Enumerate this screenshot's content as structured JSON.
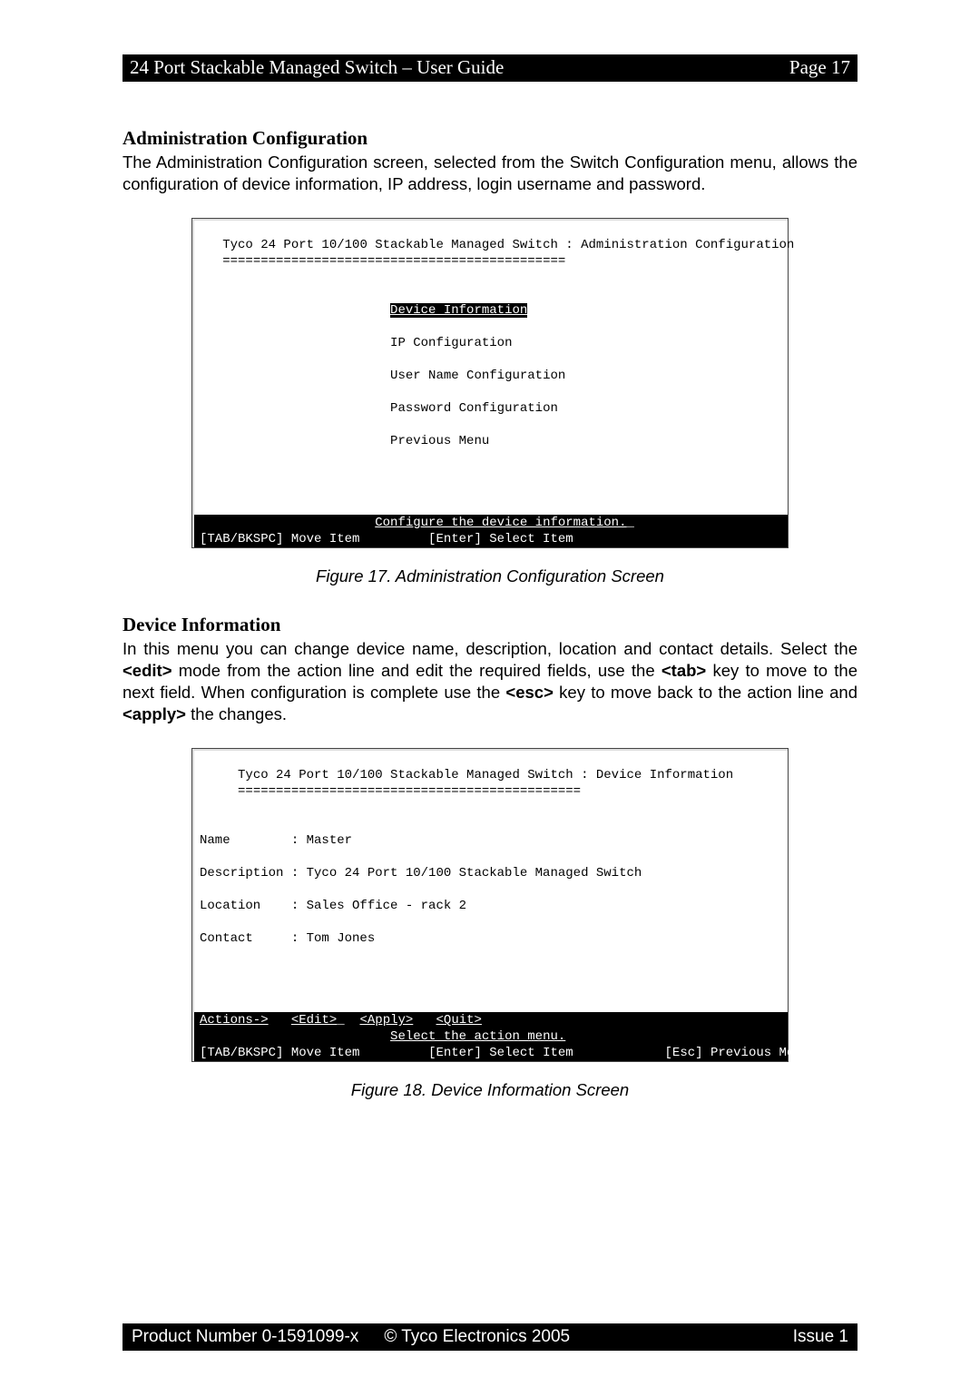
{
  "header": {
    "title": "24 Port Stackable Managed Switch – User Guide",
    "page_label": "Page 17"
  },
  "section1": {
    "heading": "Administration Configuration",
    "body": "The Administration Configuration screen, selected from the Switch Configuration menu, allows the configuration of device information, IP address, login username and password."
  },
  "terminal1": {
    "title": "Tyco 24 Port 10/100 Stackable Managed Switch : Administration Configuration",
    "rule": "=============================================",
    "menu": {
      "item1": "Device Information",
      "item2": "IP Configuration",
      "item3": "User Name Configuration",
      "item4": "Password Configuration",
      "item5": "Previous Menu"
    },
    "hint1": "Configure the device information.",
    "hint2": "[TAB/BKSPC] Move Item         [Enter] Select Item"
  },
  "caption1": "Figure 17. Administration Configuration Screen",
  "section2": {
    "heading": "Device Information",
    "body_pre": "In this menu you can change device name, description, location and contact details. Select the ",
    "edit": "<edit>",
    "body_mid1": " mode from the action line and edit the required fields, use the ",
    "tab": "<tab>",
    "body_mid2": " key to move to the next field. When configuration is complete use the ",
    "esc": "<esc>",
    "body_mid3": " key to move back to the action line and ",
    "apply": "<apply>",
    "body_end": " the changes."
  },
  "terminal2": {
    "title": "Tyco 24 Port 10/100 Stackable Managed Switch : Device Information",
    "rule": "=============================================",
    "row_name": "Name        : Master",
    "row_description": "Description : Tyco 24 Port 10/100 Stackable Managed Switch",
    "row_location": "Location    : Sales Office - rack 2",
    "row_contact": "Contact     : Tom Jones",
    "actions_label": "Actions->",
    "action_edit": "<Edit>",
    "action_apply": "<Apply>",
    "action_quit": "<Quit>",
    "hint_top": "Select the action menu.",
    "hint_bottom_left": "[TAB/BKSPC] Move Item",
    "hint_bottom_mid": "[Enter] Select Item",
    "hint_bottom_right": "[Esc] Previous Menu"
  },
  "caption2": "Figure 18. Device Information Screen",
  "footer": {
    "product": "Product Number 0-1591099-x",
    "copyright": "© Tyco Electronics 2005",
    "issue": "Issue 1"
  }
}
